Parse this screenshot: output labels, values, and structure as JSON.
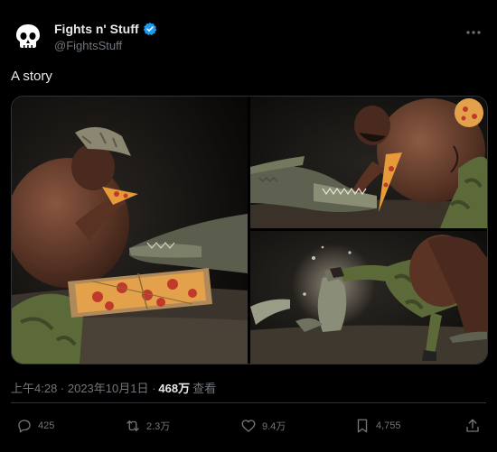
{
  "post": {
    "author": {
      "display_name": "Fights n' Stuff",
      "handle": "@FightsStuff",
      "verified": true,
      "avatar_icon": "skull-icon"
    },
    "text": "A story",
    "timestamp": "上午4:28 · 2023年10月1日 ·",
    "views_count": "468万",
    "views_label": "查看",
    "media": {
      "images": [
        {
          "description_icon": "photo-man-eating-pizza-with-crocodile"
        },
        {
          "description_icon": "photo-crocodile-biting-pizza"
        },
        {
          "description_icon": "photo-man-kicking-crocodile"
        }
      ]
    },
    "actions": {
      "replies": "425",
      "reposts": "2.3万",
      "likes": "9.4万",
      "bookmarks": "4,755"
    }
  },
  "colors": {
    "background": "#000000",
    "text_primary": "#e7e9ea",
    "text_secondary": "#71767b",
    "verified_blue": "#1d9bf0",
    "divider": "#2f3336"
  }
}
